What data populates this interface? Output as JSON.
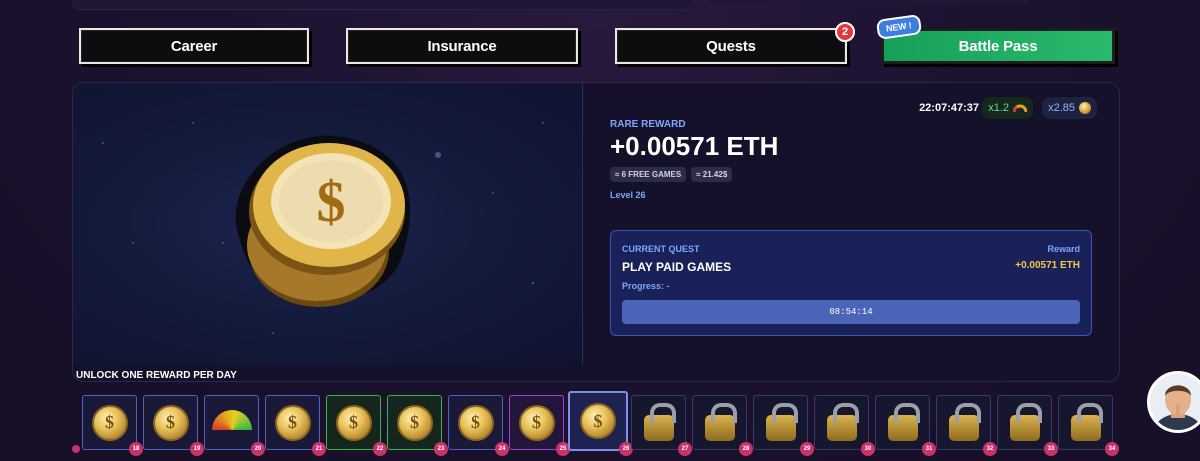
{
  "nav": {
    "career": "Career",
    "insurance": "Insurance",
    "quests": "Quests",
    "quests_badge": "2",
    "battle_pass": "Battle Pass",
    "new_badge": "NEW !"
  },
  "reward": {
    "label": "RARE REWARD",
    "amount": "+0.00571 ETH",
    "chip_games": "≈ 6 FREE GAMES",
    "chip_value": "≈ 21.42$",
    "level": "Level 26",
    "timer": "22:07:47:37",
    "multiplier_1": "x1.2",
    "multiplier_2": "x2.85"
  },
  "quest": {
    "label": "CURRENT QUEST",
    "title": "PLAY PAID GAMES",
    "progress": "Progress: -",
    "reward_label": "Reward",
    "reward_value": "+0.00571 ETH",
    "countdown": "08:54:14"
  },
  "track": {
    "title": "UNLOCK ONE REWARD PER DAY",
    "days": [
      {
        "num": "18",
        "icon": "coin-icon",
        "state": "blue"
      },
      {
        "num": "19",
        "icon": "coin-icon",
        "state": "blue"
      },
      {
        "num": "20",
        "icon": "gauge-icon",
        "state": "blue"
      },
      {
        "num": "21",
        "icon": "coin-icon",
        "state": "blue"
      },
      {
        "num": "22",
        "icon": "coin-icon",
        "state": "green"
      },
      {
        "num": "23",
        "icon": "coin-icon",
        "state": "green"
      },
      {
        "num": "24",
        "icon": "coin-icon",
        "state": "blue"
      },
      {
        "num": "25",
        "icon": "coin-icon",
        "state": "purple"
      },
      {
        "num": "26",
        "icon": "coin-icon",
        "state": "current"
      },
      {
        "num": "27",
        "icon": "lock-icon",
        "state": "locked"
      },
      {
        "num": "28",
        "icon": "lock-icon",
        "state": "locked"
      },
      {
        "num": "29",
        "icon": "lock-icon",
        "state": "locked"
      },
      {
        "num": "30",
        "icon": "lock-icon",
        "state": "locked"
      },
      {
        "num": "31",
        "icon": "lock-icon",
        "state": "locked"
      },
      {
        "num": "32",
        "icon": "lock-icon",
        "state": "locked"
      },
      {
        "num": "33",
        "icon": "lock-icon",
        "state": "locked"
      },
      {
        "num": "34",
        "icon": "lock-icon",
        "state": "locked"
      }
    ]
  },
  "colors": {
    "accent": "#7ea6ff",
    "gold": "#f4c542",
    "battle_pass": "#1fa862",
    "day_badge": "#c8336b"
  }
}
